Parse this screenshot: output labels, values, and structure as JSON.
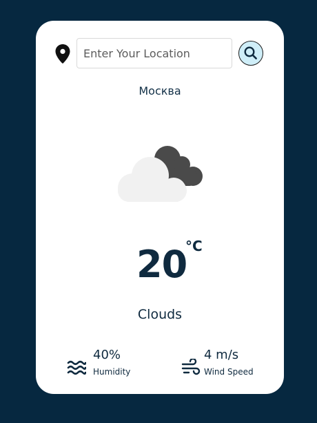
{
  "search": {
    "placeholder": "Enter Your Location",
    "value": ""
  },
  "location": {
    "city": "Москва"
  },
  "weather": {
    "icon": "cloud-icon",
    "temperature": "20",
    "unit": "°C",
    "condition": "Clouds"
  },
  "stats": {
    "humidity": {
      "value": "40%",
      "label": "Humidity",
      "icon": "humidity-icon"
    },
    "wind": {
      "value": "4 m/s",
      "label": "Wind Speed",
      "icon": "wind-icon"
    }
  },
  "colors": {
    "background": "#062840",
    "card": "#ffffff",
    "text": "#0f2a3f",
    "search_button": "#cfeef8",
    "cloud_light": "#f1f1f1",
    "cloud_dark": "#4a4a4a"
  }
}
